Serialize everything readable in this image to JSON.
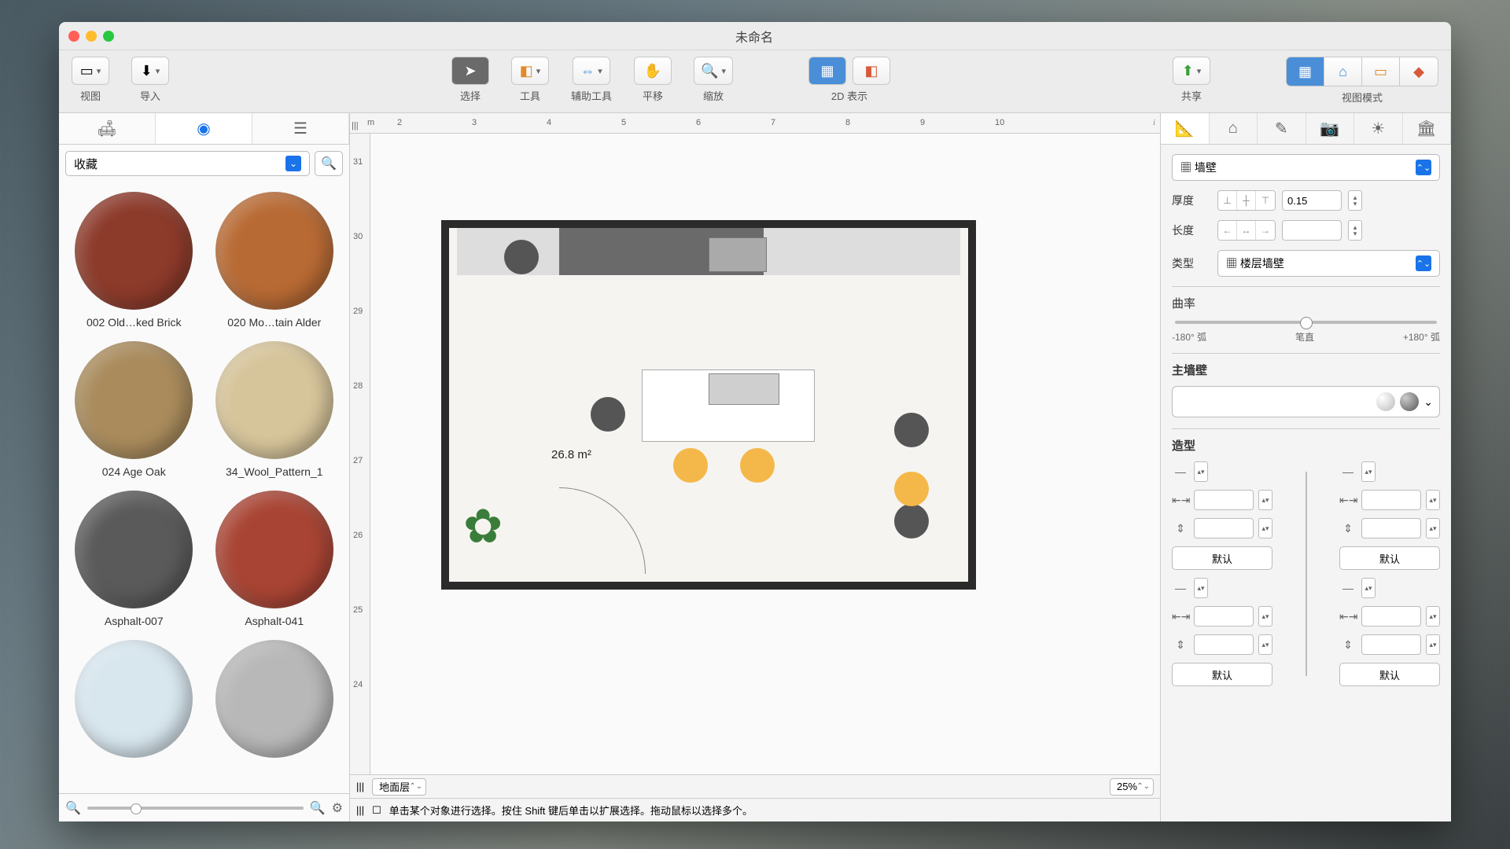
{
  "window": {
    "title": "未命名"
  },
  "toolbar": {
    "view": "视图",
    "import": "导入",
    "select": "选择",
    "tools": "工具",
    "aux": "辅助工具",
    "pan": "平移",
    "zoom": "缩放",
    "rep2d": "2D 表示",
    "share": "共享",
    "viewmode": "视图模式"
  },
  "left": {
    "category": "收藏",
    "materials": [
      {
        "label": "002 Old…ked Brick",
        "color": "#8c3a2a"
      },
      {
        "label": "020 Mo…tain Alder",
        "color": "#b86a34"
      },
      {
        "label": "024 Age Oak",
        "color": "#a98b5c"
      },
      {
        "label": "34_Wool_Pattern_1",
        "color": "#d6c49a"
      },
      {
        "label": "Asphalt-007",
        "color": "#5a5a5a"
      },
      {
        "label": "Asphalt-041",
        "color": "#a84434"
      },
      {
        "label": "",
        "color": "#d8e6ee"
      },
      {
        "label": "",
        "color": "#b8b8b8"
      }
    ]
  },
  "canvas": {
    "area_label": "26.8 m²",
    "floor_selector": "地面层",
    "zoom": "25%",
    "hint": "单击某个对象进行选择。按住 Shift 键后单击以扩展选择。拖动鼠标以选择多个。",
    "ruler_unit": "m",
    "ruler_h": [
      "2",
      "3",
      "4",
      "5",
      "6",
      "7",
      "8",
      "9",
      "10"
    ],
    "ruler_v": [
      "31",
      "30",
      "29",
      "28",
      "27",
      "26",
      "25",
      "24"
    ]
  },
  "right": {
    "object_type": "墙壁",
    "thickness_label": "厚度",
    "thickness_value": "0.15",
    "length_label": "长度",
    "type_label": "类型",
    "type_value": "楼层墙壁",
    "curvature_label": "曲率",
    "curve_min": "-180° 弧",
    "curve_mid": "笔直",
    "curve_max": "+180° 弧",
    "main_wall_label": "主墙壁",
    "shape_label": "造型",
    "default_btn": "默认"
  }
}
